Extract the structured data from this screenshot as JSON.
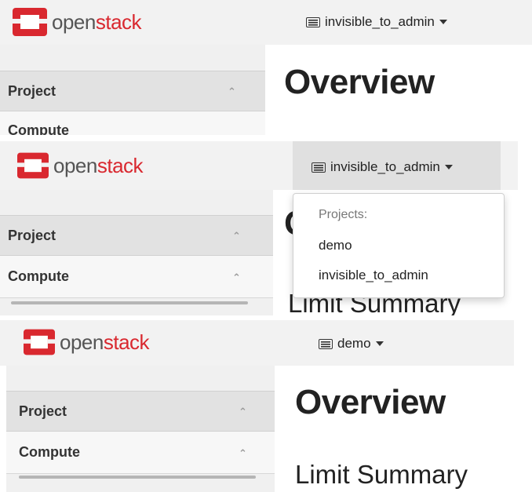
{
  "brand": {
    "open": "open",
    "stack": "stack"
  },
  "panels": [
    {
      "project_selector": "invisible_to_admin",
      "sidebar_header": "Project",
      "sidebar_sub": "Compute",
      "heading": "Overview"
    },
    {
      "project_selector": "invisible_to_admin",
      "sidebar_header": "Project",
      "sidebar_sub": "Compute",
      "heading": "Limit Summary",
      "dropdown": {
        "header": "Projects:",
        "items": [
          "demo",
          "invisible_to_admin"
        ]
      }
    },
    {
      "project_selector": "demo",
      "sidebar_header": "Project",
      "sidebar_sub": "Compute",
      "heading": "Overview",
      "subheading": "Limit Summary"
    }
  ],
  "colors": {
    "brand_red": "#d9282f",
    "topbar": "#f2f2f2",
    "sidebar": "#f0f0f0"
  },
  "icons": {
    "logo": "openstack-logo-icon",
    "selector": "keyboard-icon",
    "caret": "caret-down-icon",
    "chevron": "chevron-up-icon"
  }
}
